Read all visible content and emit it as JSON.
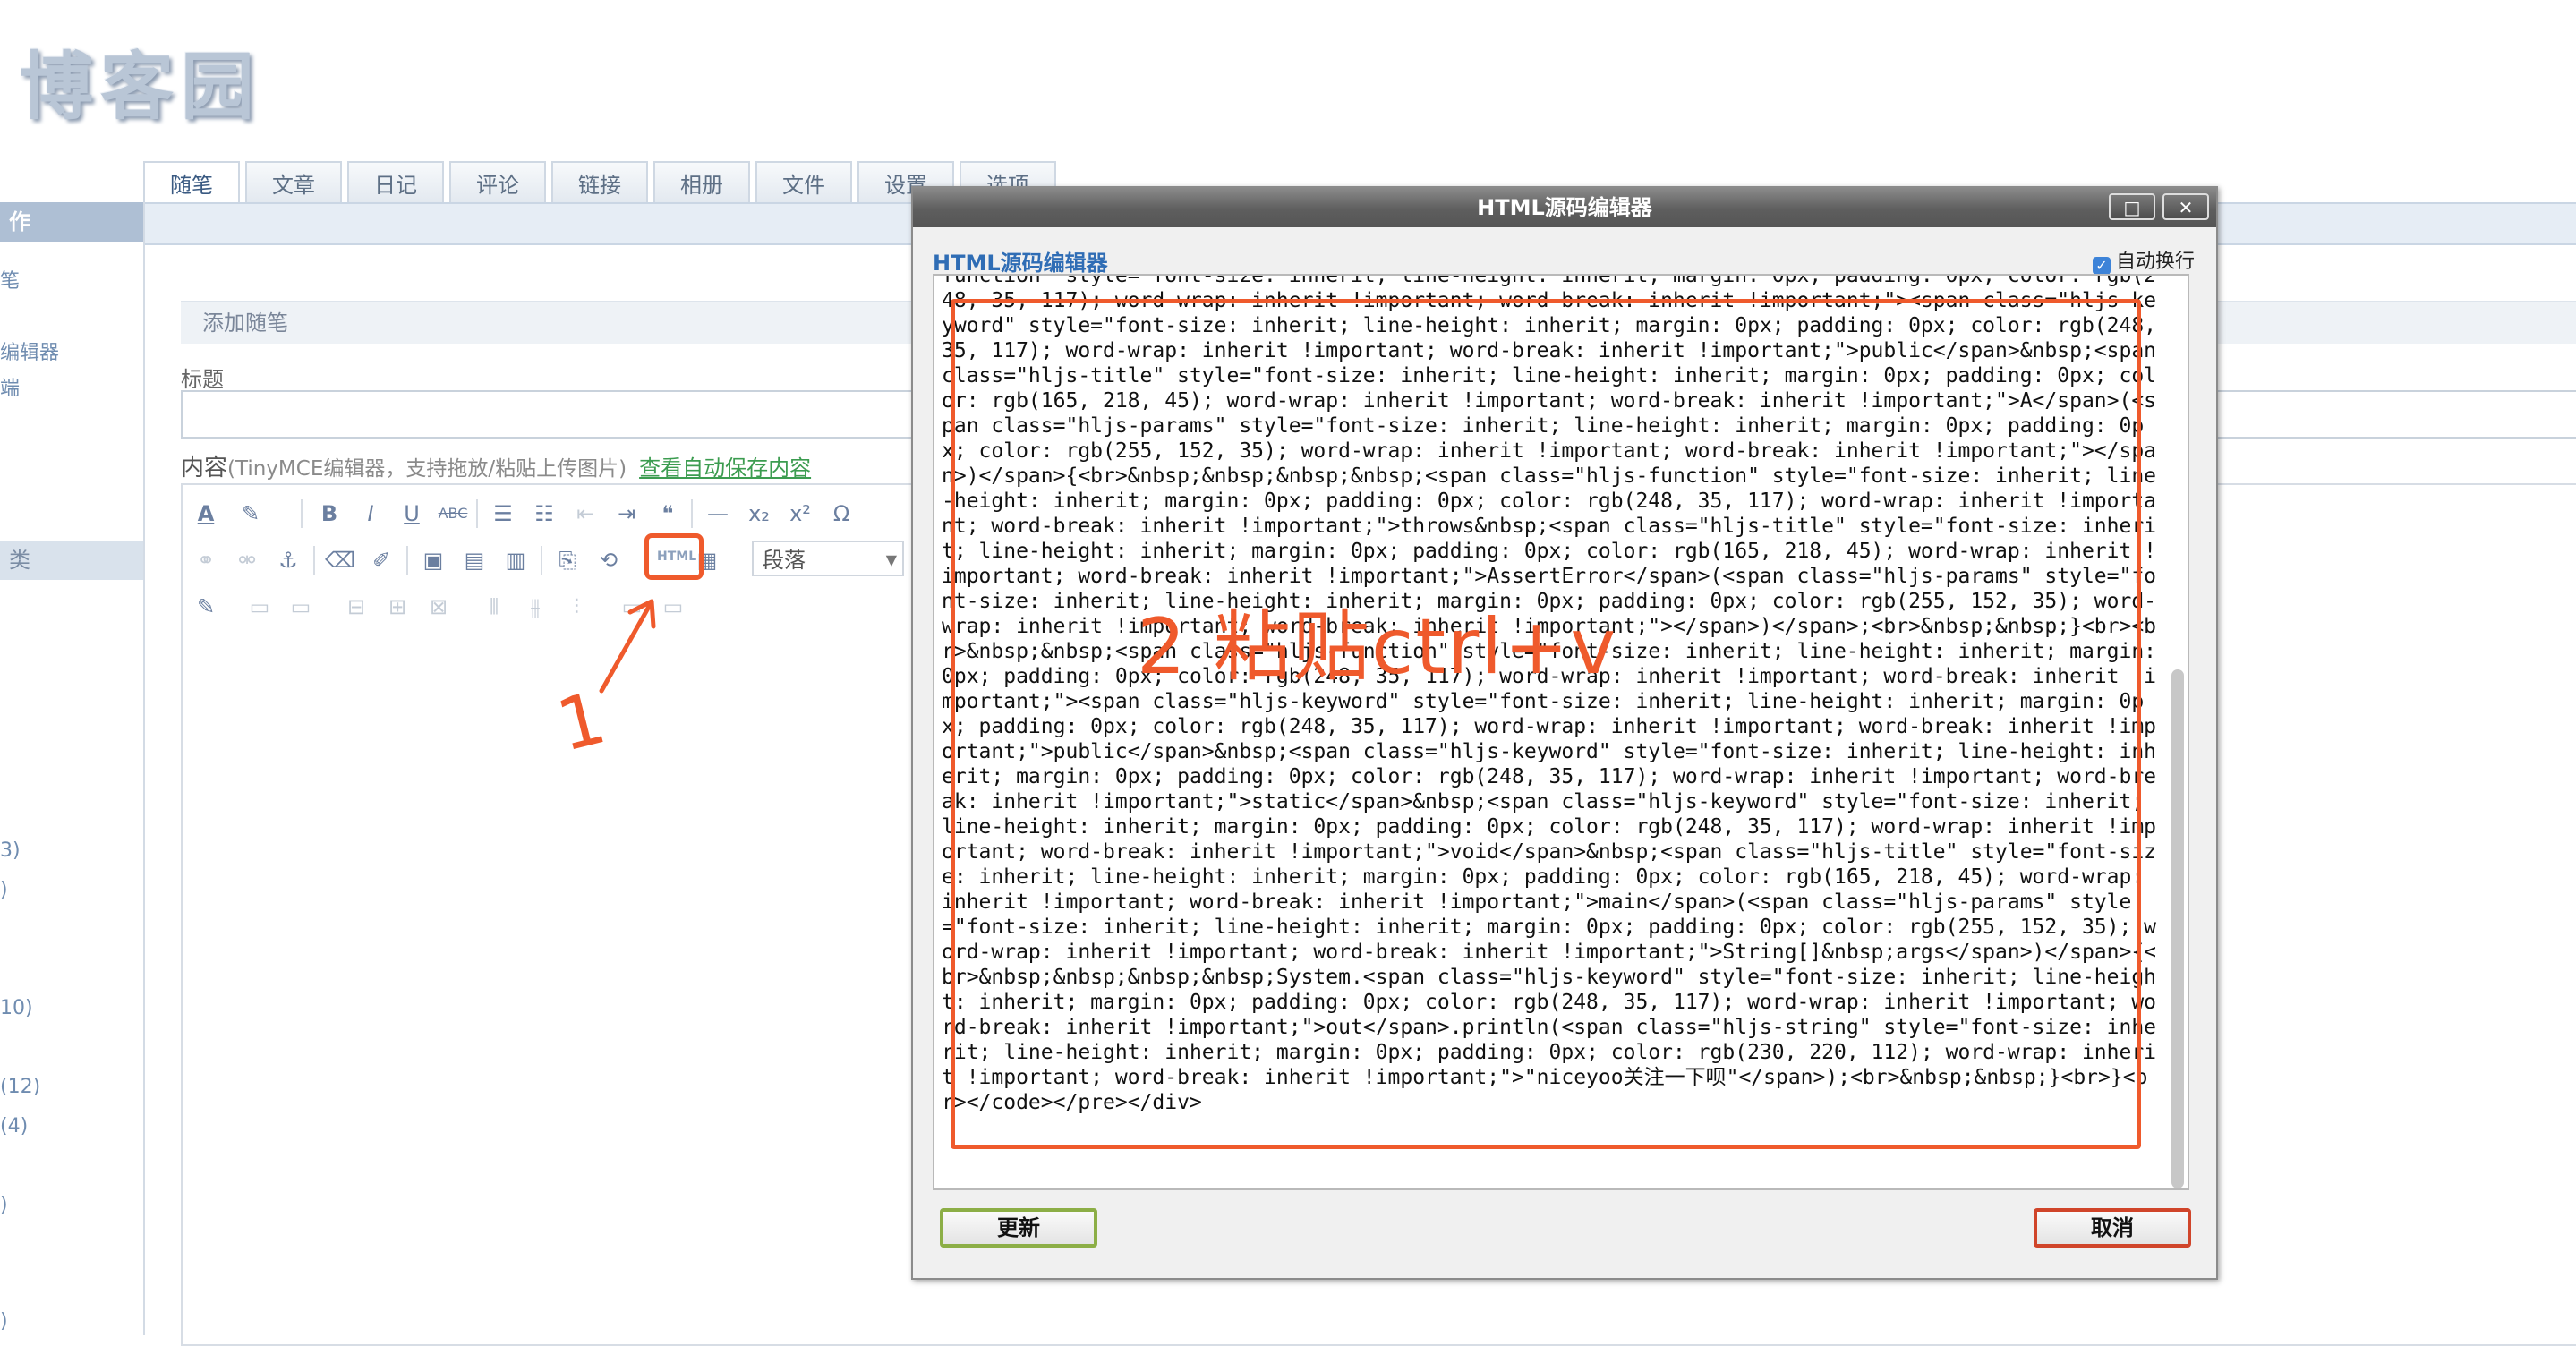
{
  "site": {
    "logo_text": "博客园"
  },
  "tabs": [
    "随笔",
    "文章",
    "日记",
    "评论",
    "链接",
    "相册",
    "文件",
    "设置",
    "选项"
  ],
  "sidebar": {
    "header": "作",
    "items": [
      "笔",
      "编辑器",
      "端"
    ],
    "section": "类",
    "counts": [
      "3)",
      ")",
      "10)",
      "(12)",
      "(4)",
      ")",
      ")"
    ]
  },
  "form": {
    "section_title": "添加随笔",
    "title_label": "标题",
    "content_label": "内容",
    "content_hint": "(TinyMCE编辑器，支持拖放/粘贴上传图片)",
    "autosave_link": "查看自动保存内容"
  },
  "toolbar": {
    "paragraph_select": "段落",
    "html_button": "HTML"
  },
  "annotations": {
    "step1": "1",
    "step2": "2 粘贴ctrl+v"
  },
  "dialog": {
    "title": "HTML源码编辑器",
    "heading": "HTML源码编辑器",
    "wrap_label": "自动换行",
    "wrap_checked": true,
    "update_button": "更新",
    "cancel_button": "取消",
    "code": "function  style=\"font-size: inherit; line-height: inherit; margin: 0px; padding: 0px; color: rgb(248, 35, 117); word-wrap: inherit !important; word-break: inherit !important;\"><span class=\"hljs-keyword\" style=\"font-size: inherit; line-height: inherit; margin: 0px; padding: 0px; color: rgb(248, 35, 117); word-wrap: inherit !important; word-break: inherit !important;\">public</span>&nbsp;<span class=\"hljs-title\" style=\"font-size: inherit; line-height: inherit; margin: 0px; padding: 0px; color: rgb(165, 218, 45); word-wrap: inherit !important; word-break: inherit !important;\">A</span>(<span class=\"hljs-params\" style=\"font-size: inherit; line-height: inherit; margin: 0px; padding: 0px; color: rgb(255, 152, 35); word-wrap: inherit !important; word-break: inherit !important;\"></span>)</span>{<br>&nbsp;&nbsp;&nbsp;&nbsp;<span class=\"hljs-function\" style=\"font-size: inherit; line-height: inherit; margin: 0px; padding: 0px; color: rgb(248, 35, 117); word-wrap: inherit !important; word-break: inherit !important;\">throws&nbsp;<span class=\"hljs-title\" style=\"font-size: inherit; line-height: inherit; margin: 0px; padding: 0px; color: rgb(165, 218, 45); word-wrap: inherit !important; word-break: inherit !important;\">AssertError</span>(<span class=\"hljs-params\" style=\"font-size: inherit; line-height: inherit; margin: 0px; padding: 0px; color: rgb(255, 152, 35); word-wrap: inherit !important; word-break: inherit !important;\"></span>)</span>;<br>&nbsp;&nbsp;}<br><br>&nbsp;&nbsp;<span class=\"hljs-function\" style=\"font-size: inherit; line-height: inherit; margin: 0px; padding: 0px; color: rgb(248, 35, 117); word-wrap: inherit !important; word-break: inherit !important;\"><span class=\"hljs-keyword\" style=\"font-size: inherit; line-height: inherit; margin: 0px; padding: 0px; color: rgb(248, 35, 117); word-wrap: inherit !important; word-break: inherit !important;\">public</span>&nbsp;<span class=\"hljs-keyword\" style=\"font-size: inherit; line-height: inherit; margin: 0px; padding: 0px; color: rgb(248, 35, 117); word-wrap: inherit !important; word-break: inherit !important;\">static</span>&nbsp;<span class=\"hljs-keyword\" style=\"font-size: inherit; line-height: inherit; margin: 0px; padding: 0px; color: rgb(248, 35, 117); word-wrap: inherit !important; word-break: inherit !important;\">void</span>&nbsp;<span class=\"hljs-title\" style=\"font-size: inherit; line-height: inherit; margin: 0px; padding: 0px; color: rgb(165, 218, 45); word-wrap: inherit !important; word-break: inherit !important;\">main</span>(<span class=\"hljs-params\" style=\"font-size: inherit; line-height: inherit; margin: 0px; padding: 0px; color: rgb(255, 152, 35); word-wrap: inherit !important; word-break: inherit !important;\">String[]&nbsp;args</span>)</span>{<br>&nbsp;&nbsp;&nbsp;&nbsp;System.<span class=\"hljs-keyword\" style=\"font-size: inherit; line-height: inherit; margin: 0px; padding: 0px; color: rgb(248, 35, 117); word-wrap: inherit !important; word-break: inherit !important;\">out</span>.println(<span class=\"hljs-string\" style=\"font-size: inherit; line-height: inherit; margin: 0px; padding: 0px; color: rgb(230, 220, 112); word-wrap: inherit !important; word-break: inherit !important;\">\"niceyoo关注一下呗\"</span>);<br>&nbsp;&nbsp;}<br>}<br></code></pre></div>"
  },
  "colors": {
    "accent_orange": "#ef5a2c",
    "dialog_heading": "#2f6db5",
    "link_green": "#3c9c50"
  }
}
